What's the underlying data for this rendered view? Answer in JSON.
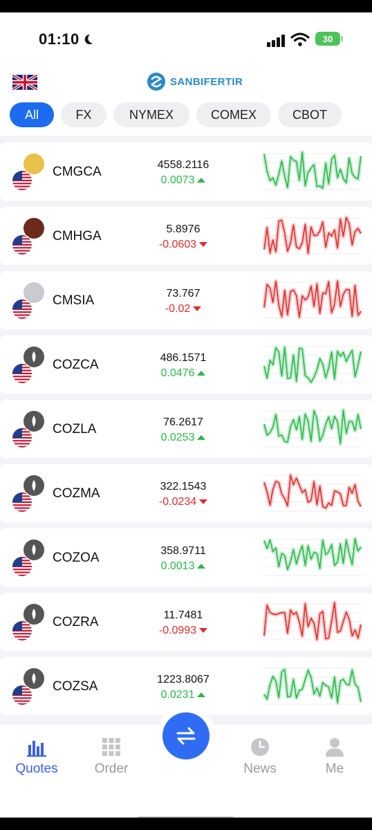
{
  "status_bar": {
    "time": "01:10",
    "battery": "30"
  },
  "header": {
    "brand": "SANBIFERTIR"
  },
  "tabs": [
    {
      "label": "All",
      "active": true
    },
    {
      "label": "FX",
      "active": false
    },
    {
      "label": "NYMEX",
      "active": false
    },
    {
      "label": "COMEX",
      "active": false
    },
    {
      "label": "CBOT",
      "active": false
    }
  ],
  "quotes": [
    {
      "symbol": "CMGCA",
      "price": "4558.2116",
      "change": "0.0073",
      "direction": "up",
      "icon": "gold-coin-icon",
      "coin_color": "#e8c14a"
    },
    {
      "symbol": "CMHGA",
      "price": "5.8976",
      "change": "-0.0603",
      "direction": "down",
      "icon": "copper-coin-icon",
      "coin_color": "#6b2a1c"
    },
    {
      "symbol": "CMSIA",
      "price": "73.767",
      "change": "-0.02",
      "direction": "down",
      "icon": "silver-coin-icon",
      "coin_color": "#c9cbd0"
    },
    {
      "symbol": "COZCA",
      "price": "486.1571",
      "change": "0.0476",
      "direction": "up",
      "icon": "corn-icon",
      "coin_color": "#555555"
    },
    {
      "symbol": "COZLA",
      "price": "76.2617",
      "change": "0.0253",
      "direction": "up",
      "icon": "oil-drop-icon",
      "coin_color": "#555555"
    },
    {
      "symbol": "COZMA",
      "price": "322.1543",
      "change": "-0.0234",
      "direction": "down",
      "icon": "soybean-meal-icon",
      "coin_color": "#555555"
    },
    {
      "symbol": "COZOA",
      "price": "358.9711",
      "change": "0.0013",
      "direction": "up",
      "icon": "oat-icon",
      "coin_color": "#555555"
    },
    {
      "symbol": "COZRA",
      "price": "11.7481",
      "change": "-0.0993",
      "direction": "down",
      "icon": "rice-icon",
      "coin_color": "#555555"
    },
    {
      "symbol": "COZSA",
      "price": "1223.8067",
      "change": "0.0231",
      "direction": "up",
      "icon": "soybean-icon",
      "coin_color": "#555555"
    }
  ],
  "colors": {
    "up": "#29b84a",
    "down": "#e02b2b",
    "accent": "#1c6bf0"
  },
  "tabbar": {
    "quotes": "Quotes",
    "order": "Order",
    "news": "News",
    "me": "Me"
  }
}
